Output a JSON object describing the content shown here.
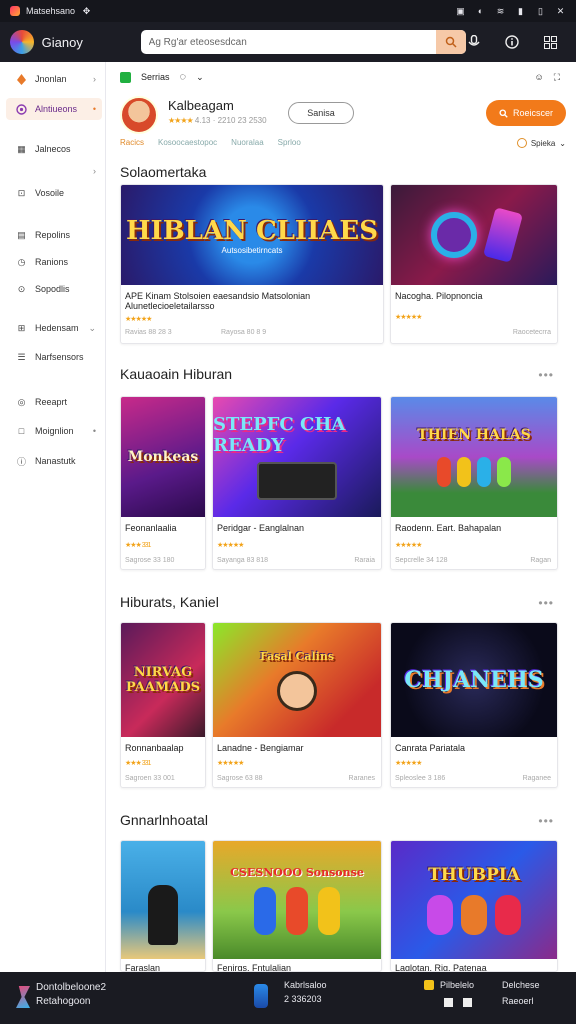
{
  "status_bar": {
    "title": "Matsehsano",
    "icons": [
      "app-icon",
      "pin-icon",
      "sim-icon",
      "volume-icon",
      "wifi-icon",
      "signal-icon",
      "battery-icon",
      "close-icon"
    ]
  },
  "topbar": {
    "brand": "Gianoy",
    "search_value": "Ag Rg'ar eteosesdcan"
  },
  "sidebar": {
    "items": [
      {
        "label": "Jnonlan",
        "icon": "flame-icon",
        "chevron": "›",
        "active": false
      },
      {
        "label": "Alntiueons",
        "icon": "target-icon",
        "chevron": "•",
        "active": true
      },
      {
        "label": "Jalnecos",
        "icon": "grid-icon",
        "chevron": "",
        "active": false
      },
      {
        "label": "",
        "icon": "",
        "chevron": "›",
        "active": false
      },
      {
        "label": "Vosoile",
        "icon": "box-icon",
        "chevron": "",
        "active": false
      },
      {
        "label": "Repolins",
        "icon": "doc-icon",
        "chevron": "",
        "active": false
      },
      {
        "label": "Ranions",
        "icon": "clock-icon",
        "chevron": "",
        "active": false
      },
      {
        "label": "Sopodlis",
        "icon": "badge-icon",
        "chevron": "",
        "active": false
      },
      {
        "label": "Hedensam",
        "icon": "users-icon",
        "chevron": "⌄",
        "active": false
      },
      {
        "label": "Narfsensors",
        "icon": "list-icon",
        "chevron": "",
        "active": false
      },
      {
        "label": "Reeaprt",
        "icon": "gauge-icon",
        "chevron": "",
        "active": false
      },
      {
        "label": "Moignlion",
        "icon": "square-icon",
        "chevron": "•",
        "active": false
      },
      {
        "label": "Nanastutk",
        "icon": "info-icon",
        "chevron": "",
        "active": false
      }
    ]
  },
  "subtoolbar": {
    "label": "Serrias"
  },
  "profile": {
    "name": "Kalbeagam",
    "rating_stars": "★★★★",
    "meta": "4.13 · 2210 23 2530",
    "follow_label": "Sanisa",
    "cta_label": "Roeicscer",
    "links": [
      "Racics",
      "Kosoocaestopoc",
      "Nuoralaa",
      "Sprloo"
    ],
    "sort_label": "Spieka"
  },
  "sections": [
    {
      "title": "Solaomertaka",
      "cards": [
        {
          "thumb_text": "HIBLAN CLIIAES",
          "thumb_caption": "Autsosibetirncats",
          "title": "APE Kinam Stolsoien eaesandsio Matsolonian Alunetlecioeletailarsso",
          "stars": "★★★★★",
          "meta": "Ravias 88 28 3",
          "meta_r": "Rayosa 80 8 9"
        },
        {
          "thumb_text": "",
          "thumb_caption": "",
          "title": "Nacogha. Pilopnoncia",
          "stars": "★★★★★",
          "meta": "",
          "meta_r": "Raocetecrra"
        }
      ]
    },
    {
      "title": "Kauaoain Hiburan",
      "cards": [
        {
          "thumb_text": "Monkeas",
          "thumb_caption": "",
          "title": "Feonanlaalia",
          "stars": "★★★ 331",
          "meta": "Sagrose 33 180",
          "meta_r": ""
        },
        {
          "thumb_text": "STEPFC CHA READY",
          "thumb_caption": "",
          "title": "Peridgar - Eanglalnan",
          "stars": "★★★★★",
          "meta": "Sayanga 83 818",
          "meta_r": "Raraia"
        },
        {
          "thumb_text": "THIEN HALAS",
          "thumb_caption": "",
          "title": "Raodenn. Eart. Bahapalan",
          "stars": "★★★★★",
          "meta": "Sepcrelle 34 128",
          "meta_r": "Ragan"
        }
      ]
    },
    {
      "title": "Hiburats, Kaniel",
      "cards": [
        {
          "thumb_text": "NIRVAG PAAMADS",
          "thumb_caption": "",
          "title": "Ronnanbaalap",
          "stars": "★★★ 331",
          "meta": "Sagroen 33 001",
          "meta_r": ""
        },
        {
          "thumb_text": "Fasal Calins",
          "thumb_caption": "",
          "title": "Lanadne - Bengiamar",
          "stars": "★★★★★",
          "meta": "Sagrose 63 88",
          "meta_r": "Raranes"
        },
        {
          "thumb_text": "CHJANEHS",
          "thumb_caption": "",
          "title": "Canrata Pariatala",
          "stars": "★★★★★",
          "meta": "Spleoslee 3 186",
          "meta_r": "Raganee"
        }
      ]
    },
    {
      "title": "Gnnarlnhoatal",
      "cards": [
        {
          "thumb_text": "",
          "thumb_caption": "",
          "title": "Faraslan",
          "stars": "",
          "meta": "",
          "meta_r": ""
        },
        {
          "thumb_text": "CSESNOOO Sonsonse",
          "thumb_caption": "",
          "title": "Fenirgs, Fntulalian",
          "stars": "",
          "meta": "",
          "meta_r": ""
        },
        {
          "thumb_text": "THUBPIA",
          "thumb_caption": "",
          "title": "Laglotan. Rig. Patenaa",
          "stars": "",
          "meta": "",
          "meta_r": ""
        }
      ]
    }
  ],
  "bottombar": {
    "left_line1": "Dontolbeloone2",
    "left_line2": "Retahogoon",
    "mid_line1": "Kabrlsaloo",
    "mid_line2": "2 336203",
    "right_line1": "Pilbelelo",
    "right_line3": "Delchese",
    "right_line4": "Raeoerl"
  },
  "colors": {
    "accent": "#f27a1a",
    "star": "#f2a31a",
    "topbar": "#1c1d25"
  }
}
